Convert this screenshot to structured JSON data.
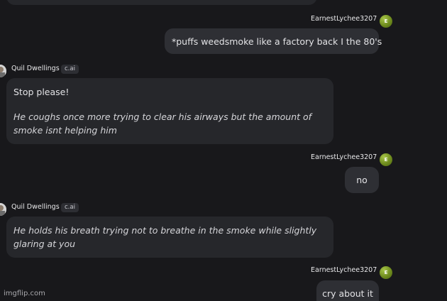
{
  "messages": [
    {
      "role": "user",
      "author": "EarnestLychee3207",
      "avatar_letter": "E",
      "text": "*puffs weedsmoke like a factory back I the 80's"
    },
    {
      "role": "character",
      "author": "Quil Dwellings",
      "badge": "c.ai",
      "text": "Stop please!",
      "italic": "He coughs once more trying to clear his airways but the amount of smoke isnt helping him"
    },
    {
      "role": "user",
      "author": "EarnestLychee3207",
      "avatar_letter": "E",
      "text": "no"
    },
    {
      "role": "character",
      "author": "Quil Dwellings",
      "badge": "c.ai",
      "italic": "He holds his breath trying not to breathe in the smoke while slightly glaring at you"
    },
    {
      "role": "user",
      "author": "EarnestLychee3207",
      "avatar_letter": "E",
      "text": "cry about it"
    }
  ],
  "watermark": "imgflip.com",
  "colors": {
    "background": "#18181b",
    "bubble_character": "#26272b",
    "bubble_user": "#2e2f34",
    "user_avatar": "#7a9a22"
  },
  "icons": {
    "user_avatar": "avatar-letter-e",
    "character_avatar": "character-portrait"
  }
}
